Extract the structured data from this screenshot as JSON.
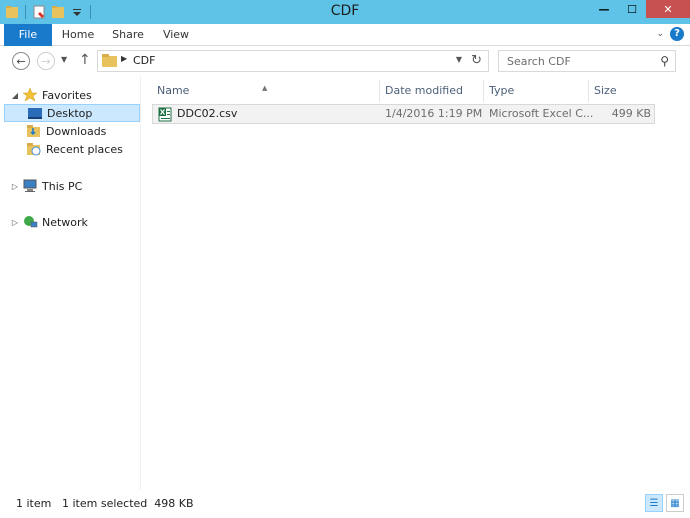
{
  "window": {
    "title": "CDF",
    "minimize": "—",
    "maximize": "☐",
    "close": "✕"
  },
  "ribbon": {
    "tabs": [
      "File",
      "Home",
      "Share",
      "View"
    ]
  },
  "address_bar": {
    "path": "CDF",
    "search_placeholder": "Search CDF"
  },
  "nav_pane": {
    "favorites_label": "Favorites",
    "favorites": [
      "Desktop",
      "Downloads",
      "Recent places"
    ],
    "this_pc": "This PC",
    "network": "Network"
  },
  "columns": {
    "name": "Name",
    "date_modified": "Date modified",
    "type": "Type",
    "size": "Size"
  },
  "files": [
    {
      "name": "DDC02.csv",
      "date_modified": "1/4/2016 1:19 PM",
      "type": "Microsoft Excel C...",
      "size": "499 KB"
    }
  ],
  "status_bar": {
    "item_count": "1 item",
    "selection": "1 item selected  498 KB"
  },
  "colors": {
    "accent": "#1979ca",
    "titlebar": "#5ec3e6",
    "close_button": "#c75050",
    "folder": "#e8c25d",
    "selection": "#cce8ff"
  }
}
